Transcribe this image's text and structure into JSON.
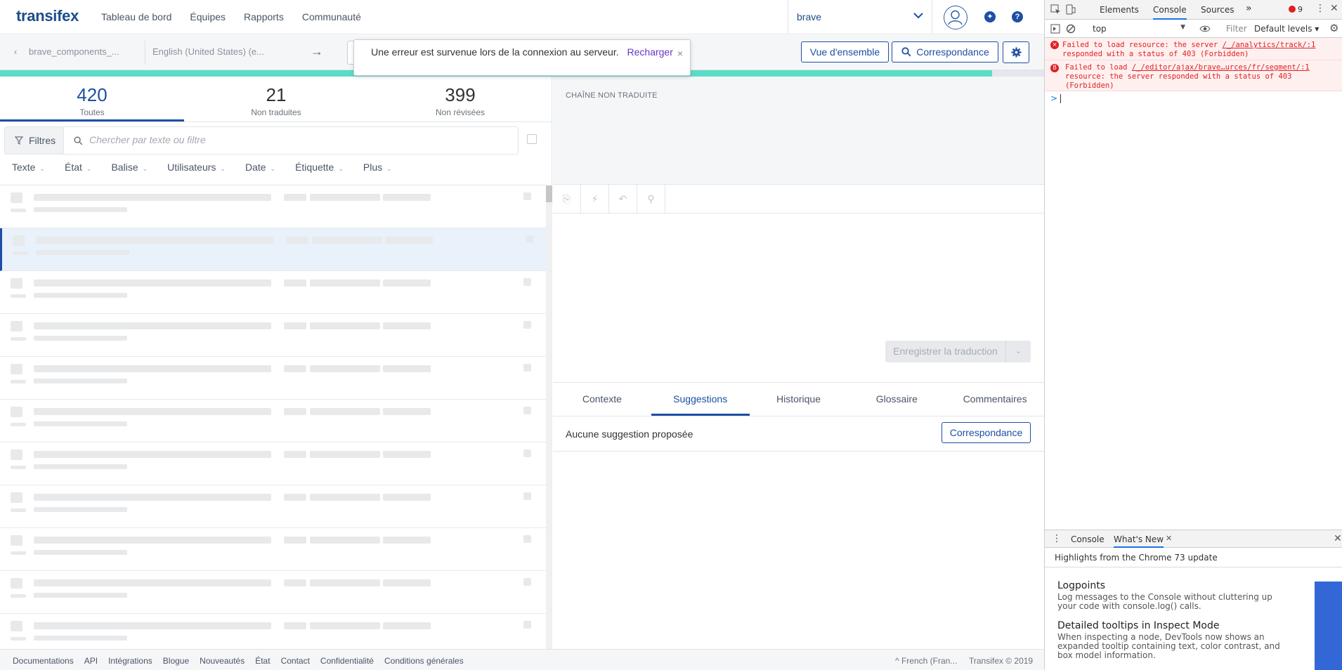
{
  "app": {
    "logo": "transifex",
    "nav": [
      "Tableau de bord",
      "Équipes",
      "Rapports",
      "Communauté"
    ],
    "project": "brave",
    "breadcrumb_resource": "brave_components_...",
    "breadcrumb_source_lang": "English (United States) (e...",
    "arrow": "→",
    "overview_btn": "Vue d'ensemble",
    "match_btn": "Correspondance",
    "toast": {
      "message": "Une erreur est survenue lors de la connexion au serveur.",
      "reload": "Recharger",
      "close": "×"
    },
    "progress_translated_fraction": 0.95,
    "stats": [
      {
        "num": "420",
        "label": "Toutes"
      },
      {
        "num": "21",
        "label": "Non traduites"
      },
      {
        "num": "399",
        "label": "Non révisées"
      }
    ],
    "filters_btn": "Filtres",
    "search_placeholder": "Chercher par texte ou filtre",
    "facets": [
      "Texte",
      "État",
      "Balise",
      "Utilisateurs",
      "Date",
      "Étiquette",
      "Plus"
    ],
    "source_header": "CHAÎNE NON TRADUITE",
    "save_btn": "Enregistrer la traduction",
    "tabs": [
      "Contexte",
      "Suggestions",
      "Historique",
      "Glossaire",
      "Commentaires"
    ],
    "active_tab": "Suggestions",
    "no_suggestion": "Aucune suggestion proposée",
    "suggest_match_btn": "Correspondance",
    "footer_links": [
      "Documentations",
      "API",
      "Intégrations",
      "Blogue",
      "Nouveautés",
      "État",
      "Contact",
      "Confidentialité",
      "Conditions générales"
    ],
    "footer_lang": "^ French (Fran...",
    "footer_copy": "Transifex © 2019",
    "colors": {
      "brand": "#1d4fa3",
      "progress": "#5bdcc6",
      "toast_link": "#6a35c7"
    }
  },
  "devtools": {
    "tabs": [
      "Elements",
      "Console",
      "Sources"
    ],
    "active_tab": "Console",
    "more": "»",
    "error_count": "9",
    "context": "top",
    "filter_label": "Filter",
    "levels": "Default levels ▾",
    "errors": [
      {
        "badge": "×",
        "text_before": "Failed to load resource: the server ",
        "link": "/_/analytics/track/:1",
        "text_after": "responded with a status of 403 (Forbidden)"
      },
      {
        "badge": "8",
        "text_before": "Failed to load  ",
        "link": "/_/editor/ajax/brave…urces/fr/segment/:1",
        "text_after": "resource: the server responded with a status of 403 (Forbidden)"
      }
    ],
    "prompt": ">",
    "drawer_tabs": [
      "Console",
      "What's New"
    ],
    "highlights": "Highlights from the Chrome 73 update",
    "whats_new": [
      {
        "title": "Logpoints",
        "desc": "Log messages to the Console without cluttering up your code with console.log() calls."
      },
      {
        "title": "Detailed tooltips in Inspect Mode",
        "desc": "When inspecting a node, DevTools now shows an expanded tooltip containing text, color contrast, and box model information."
      }
    ]
  }
}
